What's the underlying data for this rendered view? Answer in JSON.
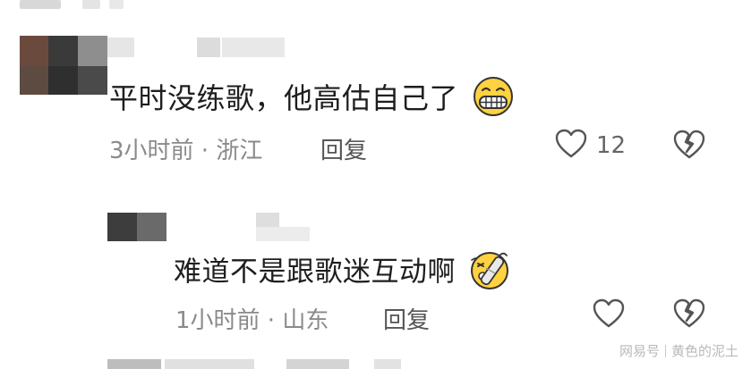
{
  "comments": [
    {
      "text": "平时没练歌，他高估自己了",
      "emoji": "grinning-teeth-emoji",
      "time": "3小时前",
      "location": "浙江",
      "reply_label": "回复",
      "like_count": "12"
    },
    {
      "text": "难道不是跟歌迷互动啊",
      "emoji": "face-with-bandage-emoji",
      "time": "1小时前",
      "location": "山东",
      "reply_label": "回复",
      "like_count": ""
    }
  ],
  "meta_separator": " · ",
  "watermark": {
    "brand": "网易号",
    "author": "黄色的泥土"
  },
  "colors": {
    "text": "#1e1e1e",
    "meta": "#8a8a8a",
    "reply": "#555555",
    "icon": "#555555",
    "watermark": "#b9b9b9"
  }
}
